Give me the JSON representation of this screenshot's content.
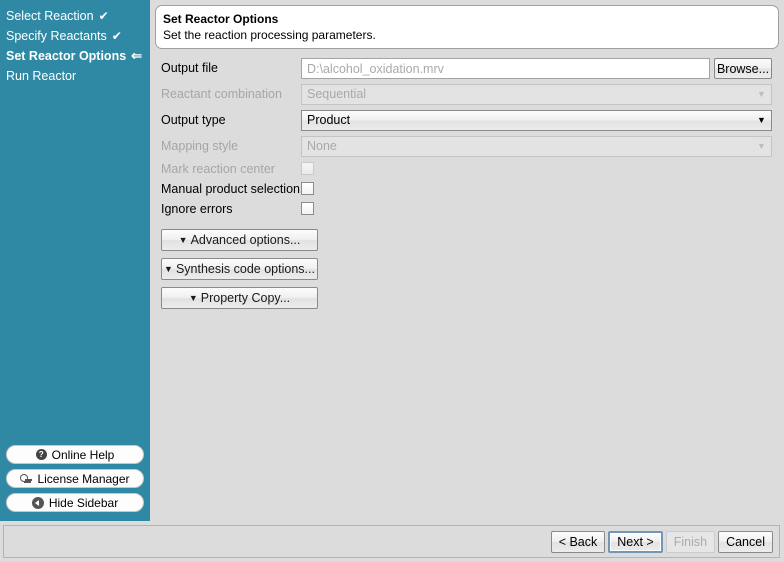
{
  "sidebar": {
    "steps": [
      {
        "label": "Select Reaction",
        "mark": "✔",
        "state": "done"
      },
      {
        "label": "Specify Reactants",
        "mark": "✔",
        "state": "done"
      },
      {
        "label": "Set Reactor Options",
        "mark": "⇐",
        "state": "current"
      },
      {
        "label": "Run Reactor",
        "mark": "",
        "state": "pending"
      }
    ],
    "buttons": [
      {
        "label": "Online Help",
        "icon": "help-circle-icon",
        "glyph": "?"
      },
      {
        "label": "License Manager",
        "icon": "key-icon",
        "glyph": ""
      },
      {
        "label": "Hide Sidebar",
        "icon": "collapse-left-icon",
        "glyph": ""
      }
    ],
    "accent_color": "#3089a4"
  },
  "header": {
    "title": "Set Reactor Options",
    "subtitle": "Set the reaction processing parameters."
  },
  "form": {
    "output_file": {
      "label": "Output file",
      "value": "",
      "placeholder": "D:\\alcohol_oxidation.mrv",
      "browse_label": "Browse..."
    },
    "reactant_combination": {
      "label": "Reactant combination",
      "value": "Sequential",
      "enabled": false
    },
    "output_type": {
      "label": "Output type",
      "value": "Product",
      "enabled": true
    },
    "mapping_style": {
      "label": "Mapping style",
      "value": "None",
      "enabled": false
    },
    "checkboxes": [
      {
        "label": "Mark reaction center",
        "checked": false,
        "enabled": false
      },
      {
        "label": "Manual product selection",
        "checked": false,
        "enabled": true
      },
      {
        "label": "Ignore errors",
        "checked": false,
        "enabled": true
      }
    ],
    "disclosure_buttons": [
      {
        "label": "Advanced options...",
        "triangle": "▼"
      },
      {
        "label": "Synthesis code options...",
        "triangle": "▼"
      },
      {
        "label": "Property Copy...",
        "triangle": "▼"
      }
    ]
  },
  "footer": {
    "buttons": [
      {
        "label": "< Back",
        "state": "normal"
      },
      {
        "label": "Next >",
        "state": "focused"
      },
      {
        "label": "Finish",
        "state": "disabled"
      },
      {
        "label": "Cancel",
        "state": "normal"
      }
    ]
  },
  "select_arrow_glyph": "▼"
}
